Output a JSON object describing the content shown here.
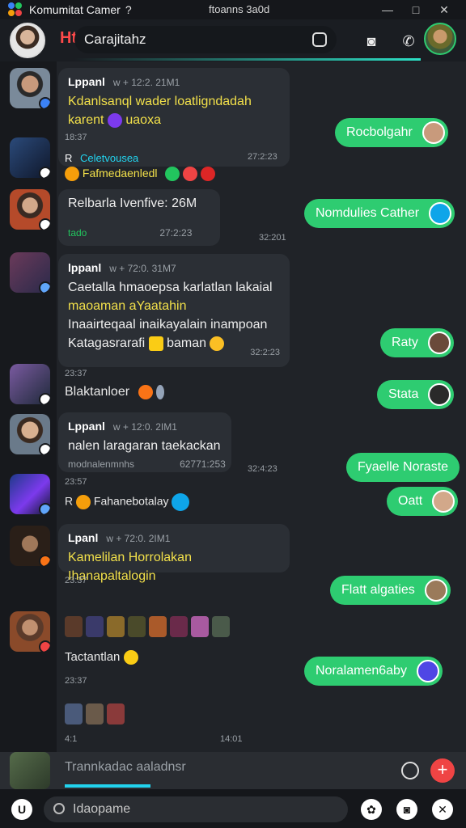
{
  "window": {
    "title": "Komumitat Camer",
    "title_mark": "?",
    "center_text": "ftoanns 3a0d",
    "controls": [
      "—",
      "□",
      "✕"
    ]
  },
  "header": {
    "logo_text": "Ht",
    "channel_name": "Carajitahz",
    "icons": [
      "camera-icon",
      "phone-icon",
      "user-avatar"
    ]
  },
  "messages_in": [
    {
      "name": "Lppanl",
      "time": "w + 12:2. 21M1",
      "line1": "Kdanlsanql wader loatligndadah",
      "line2": "karent",
      "line2b": "uaoxa"
    },
    {
      "prefix": "R",
      "name": "Celetvousea",
      "line": "Fafmedaenledl",
      "time": "27:2:23"
    },
    {
      "line": "Relbarla Ivenfive: 26M",
      "sub": "tado",
      "time": "27:2:23",
      "time2": "32:201"
    },
    {
      "name": "lppanl",
      "time": "w + 72:0. 31M7",
      "line1": "Caetalla hmaoepsa karlatlan lakaial",
      "line2": "maoaman aYaatahin",
      "line3": "Inaairteqaal inaikayalain inampoan",
      "line4": "Katagasrarafi",
      "line4b": "baman",
      "time2": "32:2:23"
    },
    {
      "time": "23:37",
      "line": "Blaktanloer"
    },
    {
      "name": "Lppanl",
      "time": "w + 12:0. 2IM1",
      "line1": "nalen laragaran taekackan",
      "sub": "modnalenmnhs",
      "time2": "62771:253",
      "time3": "32:4:23"
    },
    {
      "time": "23:57",
      "prefix": "R",
      "line": "Fahanebotalay"
    },
    {
      "name": "Lpanl",
      "time": "w + 72:0. 2IM1",
      "line1": "Kamelilan Horrolakan Ihanapaltalogin",
      "time2": "23:37"
    },
    {
      "line": "Tactantlan",
      "time": "23:37"
    },
    {
      "time": "4:1",
      "time2": "14:01"
    }
  ],
  "messages_out": [
    {
      "text": "Rocbolgahr"
    },
    {
      "text": "Nomdulies Cather"
    },
    {
      "text": "Raty"
    },
    {
      "text": "Stata"
    },
    {
      "text": "Fyaelle Noraste"
    },
    {
      "text": "Oatt"
    },
    {
      "text": "Flatt algaties"
    },
    {
      "text": "Noralamen6aby"
    }
  ],
  "input": {
    "placeholder": "Trannkadac aaladnsr"
  },
  "bottom": {
    "search_value": "Idaopame"
  },
  "colors": {
    "accent_green": "#2ecc71",
    "accent_cyan": "#22d3ee",
    "accent_red": "#ef4444",
    "highlight_yellow": "#f2e04a"
  }
}
